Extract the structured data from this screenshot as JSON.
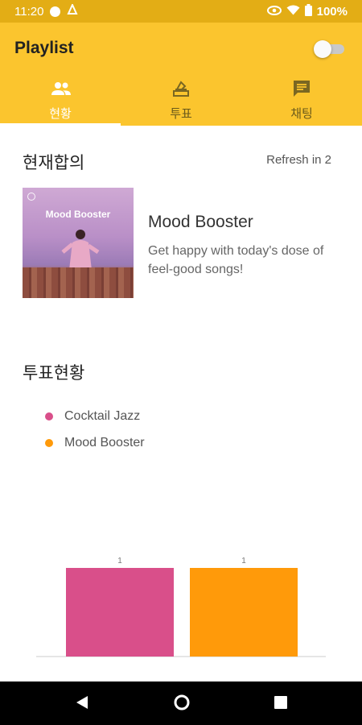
{
  "status_bar": {
    "time": "11:20",
    "battery": "100%"
  },
  "app_bar": {
    "title": "Playlist",
    "toggle_on": false
  },
  "tabs": [
    {
      "label": "현황",
      "icon": "people-icon",
      "active": true
    },
    {
      "label": "투표",
      "icon": "vote-icon",
      "active": false
    },
    {
      "label": "채팅",
      "icon": "chat-icon",
      "active": false
    }
  ],
  "consensus": {
    "title": "현재합의",
    "refresh": "Refresh in 2",
    "album_art_text": "Mood Booster",
    "playlist_name": "Mood Booster",
    "playlist_description": "Get happy with today's dose of feel-good songs!"
  },
  "vote_status": {
    "title": "투표현황"
  },
  "chart_data": {
    "type": "bar",
    "categories": [
      "Cocktail Jazz",
      "Mood Booster"
    ],
    "values": [
      1,
      1
    ],
    "ylim": [
      0,
      1
    ],
    "colors": [
      "#d94f8a",
      "#ff9a0a"
    ],
    "legend": "top-left"
  },
  "colors": {
    "status_bar": "#e3ad15",
    "app_bar": "#fbc52e"
  }
}
